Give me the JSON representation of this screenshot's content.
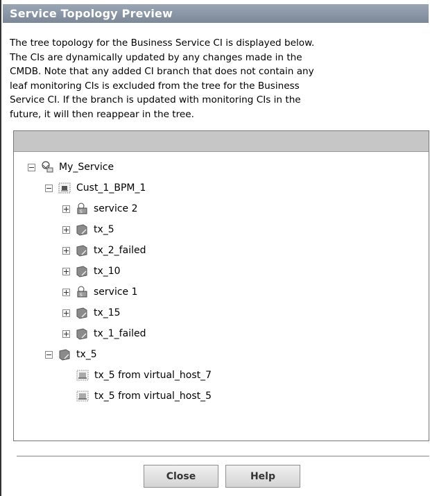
{
  "dialog": {
    "title": "Service Topology Preview",
    "description": "The tree topology for the Business Service CI is displayed below.\nThe CIs are dynamically updated by any changes made in the\nCMDB. Note that any added CI branch that does not contain any\nleaf monitoring CIs is excluded from the tree for the Business\nService CI. If the branch is updated with monitoring CIs in the\nfuture, it will then reappear in the tree."
  },
  "tree": {
    "root": {
      "label": "My_Service",
      "icon": "business-service-icon",
      "expanded": true
    },
    "group": {
      "label": "Cust_1_BPM_1",
      "icon": "monitor-group-icon",
      "expanded": true
    },
    "children": [
      {
        "label": "service 2",
        "icon": "service-icon",
        "expanded": false
      },
      {
        "label": "tx_5",
        "icon": "transaction-icon",
        "expanded": false
      },
      {
        "label": "tx_2_failed",
        "icon": "transaction-icon",
        "expanded": false
      },
      {
        "label": "tx_10",
        "icon": "transaction-icon",
        "expanded": false
      },
      {
        "label": "service 1",
        "icon": "service-icon",
        "expanded": false
      },
      {
        "label": "tx_15",
        "icon": "transaction-icon",
        "expanded": false
      },
      {
        "label": "tx_1_failed",
        "icon": "transaction-icon",
        "expanded": false
      }
    ],
    "branch": {
      "label": "tx_5",
      "icon": "transaction-icon",
      "expanded": true
    },
    "leaves": [
      {
        "label": "tx_5 from virtual_host_7",
        "icon": "monitor-leaf-icon"
      },
      {
        "label": "tx_5 from virtual_host_5",
        "icon": "monitor-leaf-icon"
      }
    ]
  },
  "buttons": {
    "close_label": "Close",
    "help_label": "Help"
  }
}
